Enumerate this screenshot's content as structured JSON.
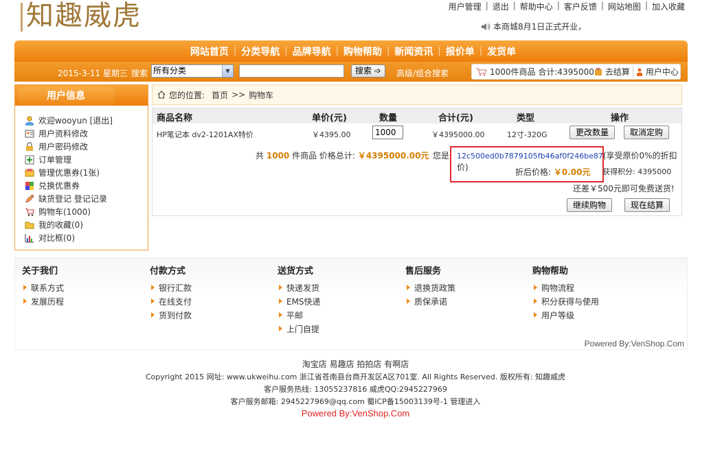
{
  "brand": {
    "logo_text": "知趣威虎"
  },
  "top_links": [
    "用户管理",
    "退出",
    "帮助中心",
    "客户反馈",
    "网站地图",
    "加入收藏"
  ],
  "notice": "本商城8月1日正式开业，",
  "nav": [
    "网站首页",
    "分类导航",
    "品牌导航",
    "购物帮助",
    "新闻资讯",
    "报价单",
    "发货单"
  ],
  "toolbar": {
    "date": "2015-3-11 星期三",
    "search_label": "搜索",
    "category_selected": "所有分类",
    "search_button": "搜索",
    "advanced": "高级/组合搜索",
    "cart_summary": "1000件商品 合计:4395000",
    "checkout": "去结算",
    "user_center": "用户中心"
  },
  "sidebar": {
    "title": "用户信息",
    "items": [
      "欢迎wooyun [退出]",
      "用户资料修改",
      "用户密码修改",
      "订单管理",
      "管理优惠券(1张)",
      "兑换优惠券",
      "缺货登记 登记记录",
      "购物车(1000)",
      "我的收藏(0)",
      "对比框(0)"
    ]
  },
  "breadcrumb": {
    "label": "您的位置:",
    "home": "首页",
    "sep": ">>",
    "current": "购物车"
  },
  "cart": {
    "headers": [
      "商品名称",
      "单价(元)",
      "数量",
      "合计(元)",
      "类型",
      "操作"
    ],
    "row": {
      "name": "HP笔记本 dv2-1201AX特价",
      "price": "￥4395.00",
      "qty": "1000",
      "total": "￥4395000.00",
      "type": "12寸-320G",
      "update_btn": "更改数量",
      "cancel_btn": "取消定购"
    },
    "summary_prefix": "共",
    "summary_count": "1000",
    "summary_mid": "件商品 价格总计:",
    "summary_total": "￥4395000.00元",
    "member_prefix": "您是",
    "member_code": "12c500ed0b7879105fb46af0f246be87",
    "member_suffix": "(享受原价0%的折扣价)",
    "discount_label": "折后价格:",
    "discount_price": "￥0.00元",
    "points": "获得积分: 4395000",
    "free_ship": "还差￥500元即可免费送货!",
    "continue_btn": "继续购物",
    "checkout_btn": "现在结算"
  },
  "footer_cols": [
    {
      "title": "关于我们",
      "items": [
        "联系方式",
        "发展历程"
      ]
    },
    {
      "title": "付款方式",
      "items": [
        "银行汇款",
        "在线支付",
        "货到付款"
      ]
    },
    {
      "title": "送货方式",
      "items": [
        "快递发货",
        "EMS快递",
        "平邮",
        "上门自提"
      ]
    },
    {
      "title": "售后服务",
      "items": [
        "退换货政策",
        "质保承诺"
      ]
    },
    {
      "title": "购物帮助",
      "items": [
        "购物流程",
        "积分获得与使用",
        "用户等级"
      ]
    }
  ],
  "powered_top": "Powered By:VenShop.Com",
  "bottom": {
    "links": "淘宝店 易趣店 拍拍店 有啊店",
    "copyright": "Copyright 2015 网址: www.ukweihu.com 浙江省苍南县台商开发区A区701室. All Rights Reserved. 版权所有: 知趣威虎",
    "hotline": "客户服务热线: 13055237816 威虎QQ:2945227969",
    "email": "客户服务邮箱: 2945227969@qq.com 蜀ICP备15003139号-1 管理进入",
    "powered": "Powered By:VenShop.Com"
  }
}
